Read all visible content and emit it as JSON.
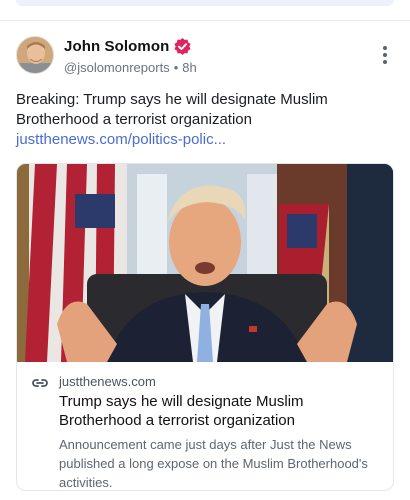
{
  "post": {
    "author_name": "John Solomon",
    "handle": "@jsolomonreports",
    "separator": "•",
    "time_ago": "8h",
    "text": "Breaking: Trump says he will designate Muslim Brotherhood a terrorist organization ",
    "link_text": "justthenews.com/politics-polic...",
    "verified_color": "#e0245e",
    "link_color": "#4a6cd4"
  },
  "card": {
    "domain": "justthenews.com",
    "title": "Trump says he will designate Muslim Brotherhood a terrorist organization",
    "description": "Announcement came just days after Just the News published a long expose on the Muslim Brotherhood's activities."
  },
  "icons": {
    "verified": "verified-badge-icon",
    "more": "more-options-icon",
    "link": "link-icon"
  }
}
